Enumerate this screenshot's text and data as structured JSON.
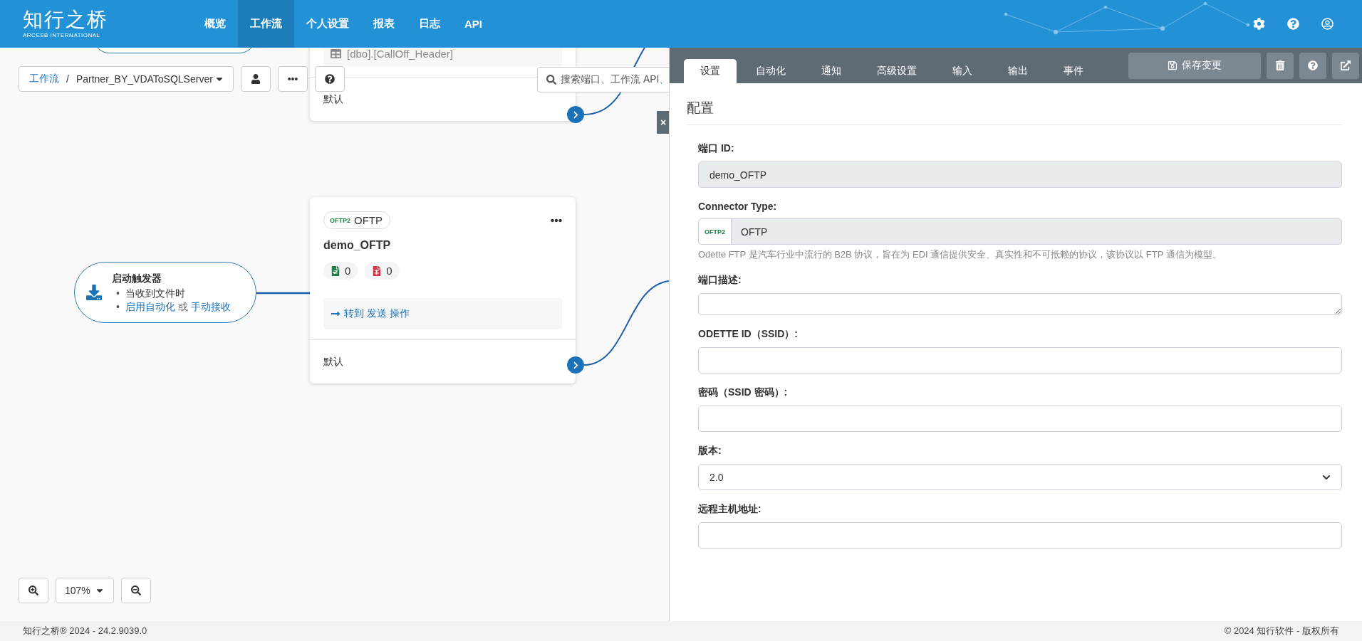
{
  "header": {
    "logo": "知行之桥",
    "logo_sub": "ARCESB INTERNATIONAL",
    "nav": [
      {
        "label": "概览",
        "selected": false
      },
      {
        "label": "工作流",
        "selected": true
      },
      {
        "label": "个人设置",
        "selected": false
      },
      {
        "label": "报表",
        "selected": false
      },
      {
        "label": "日志",
        "selected": false
      },
      {
        "label": "API",
        "selected": false
      }
    ]
  },
  "canvas": {
    "breadcrumb": {
      "root": "工作流",
      "separator": "/",
      "current": "Partner_BY_VDAToSQLServer"
    },
    "search": {
      "placeholder": "搜索端口、工作流 API、"
    },
    "close": "×",
    "top_card": {
      "table": "[dbo].[CallOff_Header]",
      "output": "默认"
    },
    "trigger": {
      "title": "启动触发器",
      "items": [
        {
          "kind": "text",
          "marker": "•",
          "text": "当收到文件时"
        },
        {
          "kind": "links",
          "marker": "•",
          "parts": [
            {
              "kind": "link",
              "text": "启用自动化"
            },
            {
              "kind": "text",
              "text": "或"
            },
            {
              "kind": "link",
              "text": "手动接收"
            }
          ]
        }
      ]
    },
    "card": {
      "badge_logo": "OFTP2",
      "badge": "OFTP",
      "name": "demo_OFTP",
      "counts": [
        {
          "value": "0",
          "color": "#1e7e45"
        },
        {
          "value": "0",
          "color": "#dc3545"
        }
      ],
      "action": "转到 发送 操作",
      "output": "默认"
    },
    "zoom": {
      "level": "107%"
    }
  },
  "panel": {
    "tabs": [
      {
        "label": "设置",
        "selected": true
      },
      {
        "label": "自动化",
        "selected": false
      },
      {
        "label": "通知",
        "selected": false
      },
      {
        "label": "高级设置",
        "selected": false
      },
      {
        "label": "输入",
        "selected": false
      },
      {
        "label": "输出",
        "selected": false
      },
      {
        "label": "事件",
        "selected": false
      }
    ],
    "save": "保存变更",
    "section": "配置",
    "fields": [
      {
        "kind": "input",
        "label": "端口 ID:",
        "value": "demo_OFTP",
        "readonly": true
      },
      {
        "kind": "connector",
        "label": "Connector Type:",
        "logo": "OFTP2",
        "value": "OFTP",
        "readonly": true,
        "note": "Odette FTP 是汽车行业中流行的 B2B 协议，旨在为 EDI 通信提供安全、真实性和不可抵赖的协议，该协议以 FTP 通信为模型。"
      },
      {
        "kind": "textarea",
        "label": "端口描述:",
        "readonly": false
      },
      {
        "kind": "input",
        "label": "ODETTE ID（SSID）:",
        "readonly": false
      },
      {
        "kind": "input",
        "label": "密码（SSID 密码）:",
        "readonly": false
      },
      {
        "kind": "select",
        "label": "版本:",
        "value": "2.0",
        "readonly": false
      },
      {
        "kind": "input",
        "label": "远程主机地址:",
        "readonly": false
      }
    ]
  },
  "footer": {
    "left": "知行之桥® 2024 - 24.2.9039.0",
    "right": "© 2024 知行软件 - 版权所有"
  }
}
